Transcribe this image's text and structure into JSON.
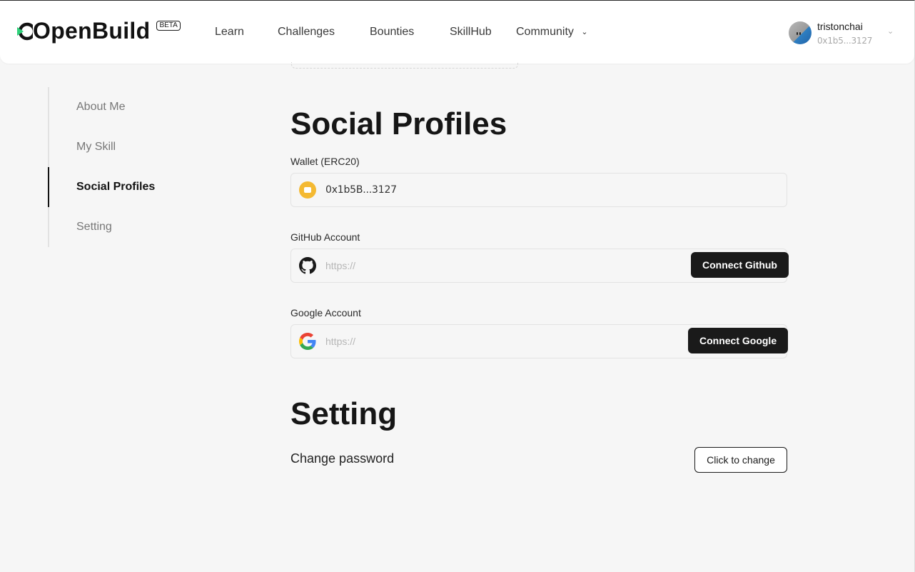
{
  "brand": {
    "name": "OpenBuild",
    "badge": "BETA",
    "accent": "#2ed17a"
  },
  "nav": {
    "items": [
      {
        "label": "Learn"
      },
      {
        "label": "Challenges"
      },
      {
        "label": "Bounties"
      },
      {
        "label": "SkillHub"
      },
      {
        "label": "Community"
      }
    ]
  },
  "user": {
    "name": "tristonchai",
    "address": "0x1b5...3127"
  },
  "sidebar": {
    "items": [
      {
        "label": "About Me"
      },
      {
        "label": "My Skill"
      },
      {
        "label": "Social Profiles",
        "active": true
      },
      {
        "label": "Setting"
      }
    ]
  },
  "social": {
    "title": "Social Profiles",
    "wallet": {
      "label": "Wallet (ERC20)",
      "value": "0x1b5B...3127",
      "icon": "wallet-icon"
    },
    "github": {
      "label": "GitHub Account",
      "placeholder": "https://",
      "button": "Connect Github",
      "icon": "github-icon"
    },
    "google": {
      "label": "Google Account",
      "placeholder": "https://",
      "button": "Connect Google",
      "icon": "google-icon"
    }
  },
  "setting": {
    "title": "Setting",
    "password_label": "Change password",
    "password_button": "Click to change"
  }
}
